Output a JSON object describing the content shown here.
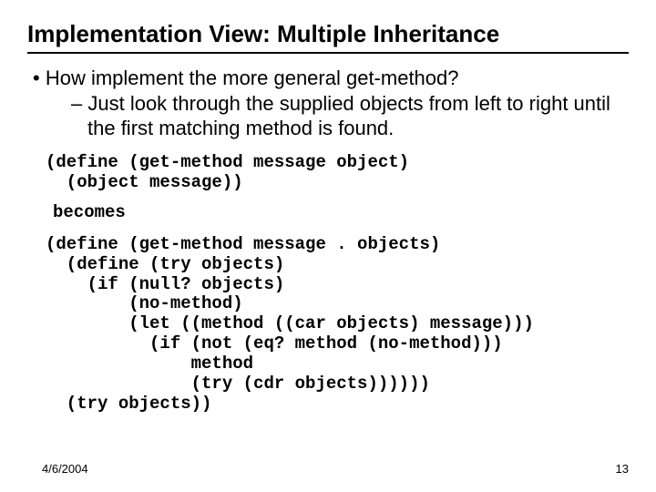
{
  "title": "Implementation View: Multiple Inheritance",
  "bullets": {
    "b1": "How implement the more general get-method?",
    "b2": "Just look through the supplied objects from left to right until the first matching method is found."
  },
  "code1": "(define (get-method message object)\n  (object message))",
  "becomes": "becomes",
  "code2": "(define (get-method message . objects)\n  (define (try objects)\n    (if (null? objects)\n        (no-method)\n        (let ((method ((car objects) message)))\n          (if (not (eq? method (no-method)))\n              method\n              (try (cdr objects))))))\n  (try objects))",
  "footer": {
    "date": "4/6/2004",
    "page": "13"
  }
}
